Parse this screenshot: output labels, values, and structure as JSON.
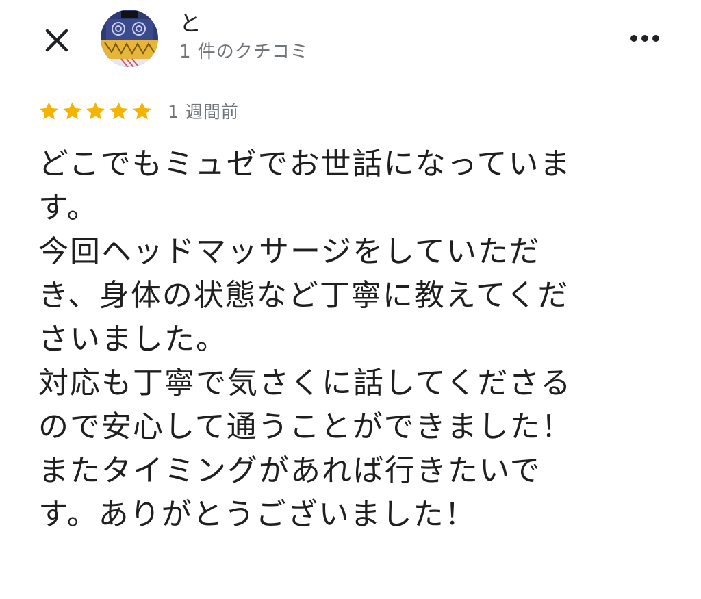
{
  "header": {
    "close_icon": "close-icon",
    "author_name": "と",
    "review_count": "1 件のクチコミ",
    "more_icon": "more-vert-icon"
  },
  "review": {
    "rating": 5,
    "max_rating": 5,
    "star_color": "#f4b400",
    "date": "1 週間前",
    "lines": [
      "どこでもミュゼでお世話になっていま",
      "す。",
      "今回ヘッドマッサージをしていただ",
      "き、身体の状態など丁寧に教えてくだ",
      "さいました。",
      "対応も丁寧で気さくに話してくださる",
      "ので安心して通うことができました！",
      "またタイミングがあれば行きたいで",
      "す。ありがとうございました！"
    ]
  }
}
